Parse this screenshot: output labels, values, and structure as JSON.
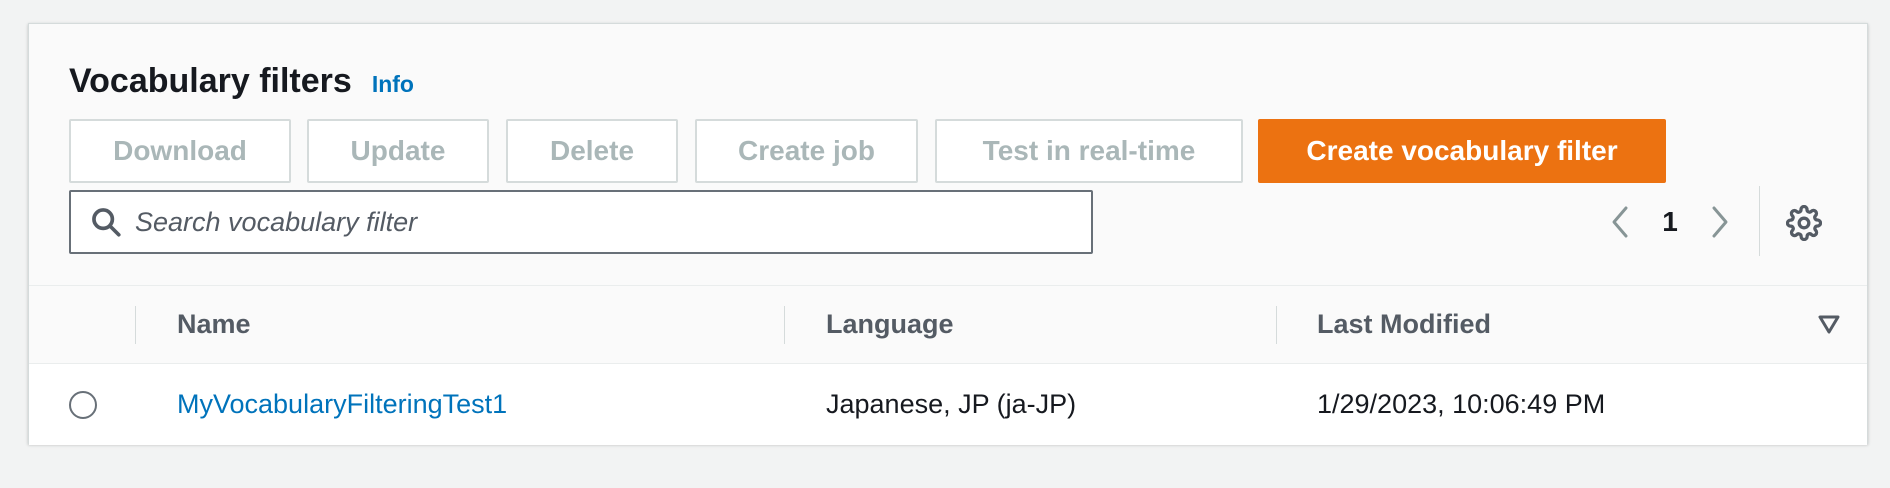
{
  "section": {
    "title": "Vocabulary filters",
    "info_label": "Info"
  },
  "actions": {
    "download": "Download",
    "update": "Update",
    "delete": "Delete",
    "create_job": "Create job",
    "test_realtime": "Test in real-time",
    "create_filter": "Create vocabulary filter"
  },
  "colors": {
    "primary_button": "#ec7211",
    "link": "#0073bb",
    "disabled_text": "#aab7b8"
  },
  "search": {
    "placeholder": "Search vocabulary filter",
    "value": "",
    "icon": "search-icon"
  },
  "pagination": {
    "current_page": "1",
    "prev_icon": "chevron-left-icon",
    "next_icon": "chevron-right-icon",
    "settings_icon": "gear-icon"
  },
  "table": {
    "columns": [
      "Name",
      "Language",
      "Last Modified"
    ],
    "sort_icon": "sort-down-icon",
    "rows": [
      {
        "name": "MyVocabularyFilteringTest1",
        "language": "Japanese, JP (ja-JP)",
        "last_modified": "1/29/2023, 10:06:49 PM",
        "selected": false
      }
    ]
  }
}
